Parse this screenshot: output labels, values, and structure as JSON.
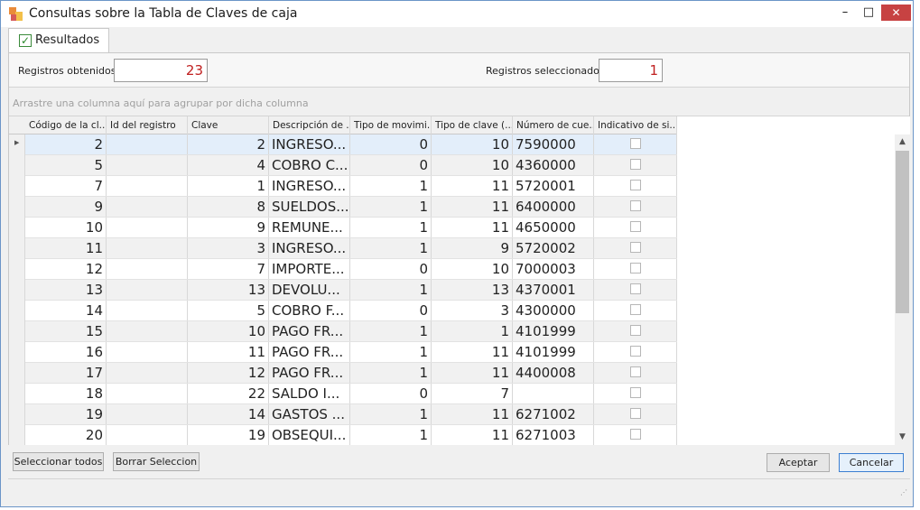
{
  "window": {
    "title": "Consultas sobre la Tabla de Claves de caja",
    "minimize": "–",
    "maximize": "□",
    "close": "✕"
  },
  "tab": {
    "label": "Resultados",
    "check": "✓"
  },
  "summary": {
    "obtained_label": "Registros obtenidos:",
    "obtained_value": "23",
    "selected_label": "Registros seleccionados:",
    "selected_value": "1"
  },
  "grid": {
    "group_hint": "Arrastre una columna aquí para agrupar por dicha columna",
    "columns": [
      "Código de la cl...",
      "Id del registro",
      "Clave",
      "Descripción de ...",
      "Tipo de movimi...",
      "Tipo de clave (...",
      "Número de cue...",
      "Indicativo de si..."
    ],
    "rows": [
      {
        "codigo": "2",
        "id": "",
        "clave": "2",
        "desc": "INGRESO...",
        "tipo_mov": "0",
        "tipo_clave": "10",
        "cuenta": "7590000",
        "indicativo": false
      },
      {
        "codigo": "5",
        "id": "",
        "clave": "4",
        "desc": "COBRO C...",
        "tipo_mov": "0",
        "tipo_clave": "10",
        "cuenta": "4360000",
        "indicativo": false
      },
      {
        "codigo": "7",
        "id": "",
        "clave": "1",
        "desc": "INGRESO...",
        "tipo_mov": "1",
        "tipo_clave": "11",
        "cuenta": "5720001",
        "indicativo": false
      },
      {
        "codigo": "9",
        "id": "",
        "clave": "8",
        "desc": "SUELDOS...",
        "tipo_mov": "1",
        "tipo_clave": "11",
        "cuenta": "6400000",
        "indicativo": false
      },
      {
        "codigo": "10",
        "id": "",
        "clave": "9",
        "desc": "REMUNE...",
        "tipo_mov": "1",
        "tipo_clave": "11",
        "cuenta": "4650000",
        "indicativo": false
      },
      {
        "codigo": "11",
        "id": "",
        "clave": "3",
        "desc": "INGRESO...",
        "tipo_mov": "1",
        "tipo_clave": "9",
        "cuenta": "5720002",
        "indicativo": false
      },
      {
        "codigo": "12",
        "id": "",
        "clave": "7",
        "desc": "IMPORTE...",
        "tipo_mov": "0",
        "tipo_clave": "10",
        "cuenta": "7000003",
        "indicativo": false
      },
      {
        "codigo": "13",
        "id": "",
        "clave": "13",
        "desc": "DEVOLU...",
        "tipo_mov": "1",
        "tipo_clave": "13",
        "cuenta": "4370001",
        "indicativo": false
      },
      {
        "codigo": "14",
        "id": "",
        "clave": "5",
        "desc": "COBRO F...",
        "tipo_mov": "0",
        "tipo_clave": "3",
        "cuenta": "4300000",
        "indicativo": false
      },
      {
        "codigo": "15",
        "id": "",
        "clave": "10",
        "desc": "PAGO FR...",
        "tipo_mov": "1",
        "tipo_clave": "1",
        "cuenta": "4101999",
        "indicativo": false
      },
      {
        "codigo": "16",
        "id": "",
        "clave": "11",
        "desc": "PAGO FR...",
        "tipo_mov": "1",
        "tipo_clave": "11",
        "cuenta": "4101999",
        "indicativo": false
      },
      {
        "codigo": "17",
        "id": "",
        "clave": "12",
        "desc": "PAGO FR...",
        "tipo_mov": "1",
        "tipo_clave": "11",
        "cuenta": "4400008",
        "indicativo": false
      },
      {
        "codigo": "18",
        "id": "",
        "clave": "22",
        "desc": "SALDO I...",
        "tipo_mov": "0",
        "tipo_clave": "7",
        "cuenta": "",
        "indicativo": false
      },
      {
        "codigo": "19",
        "id": "",
        "clave": "14",
        "desc": "GASTOS ...",
        "tipo_mov": "1",
        "tipo_clave": "11",
        "cuenta": "6271002",
        "indicativo": false
      },
      {
        "codigo": "20",
        "id": "",
        "clave": "19",
        "desc": "OBSEQUI...",
        "tipo_mov": "1",
        "tipo_clave": "11",
        "cuenta": "6271003",
        "indicativo": false
      }
    ],
    "row_indicator": "▶",
    "scroll_up": "▲",
    "scroll_down": "▼"
  },
  "buttons": {
    "select_all": "Seleccionar todos",
    "clear_selection": "Borrar Seleccion",
    "accept": "Aceptar",
    "cancel": "Cancelar"
  },
  "status": {
    "grip": "⋰"
  }
}
